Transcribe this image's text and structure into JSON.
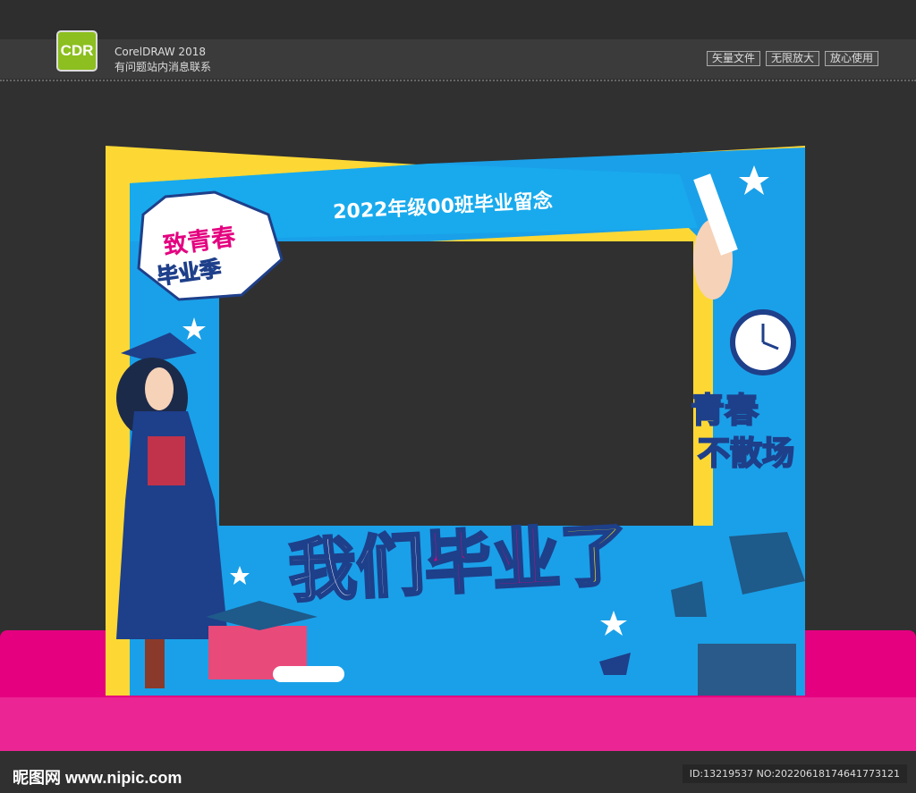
{
  "header": {
    "logo": "CDR",
    "app_name": "CorelDRAW 2018",
    "subtitle": "有问题站内消息联系",
    "tags": [
      "矢量文件",
      "无限放大",
      "放心使用"
    ]
  },
  "poster": {
    "banner": "2022年级00班毕业留念",
    "badge_line1": "致青春",
    "badge_line2": "毕业季",
    "side_line1": "青春",
    "side_line2": "不散场",
    "main_title_a": "我们",
    "main_title_b": "毕业",
    "main_title_c": "了"
  },
  "colors": {
    "blue": "#1aa0e8",
    "yellow": "#fdd835",
    "pink": "#e4007f",
    "navy": "#1e3f8a"
  },
  "footer": {
    "site": "昵图网 www.nipic.com",
    "id": "ID:13219537 NO:20220618174641773121"
  }
}
